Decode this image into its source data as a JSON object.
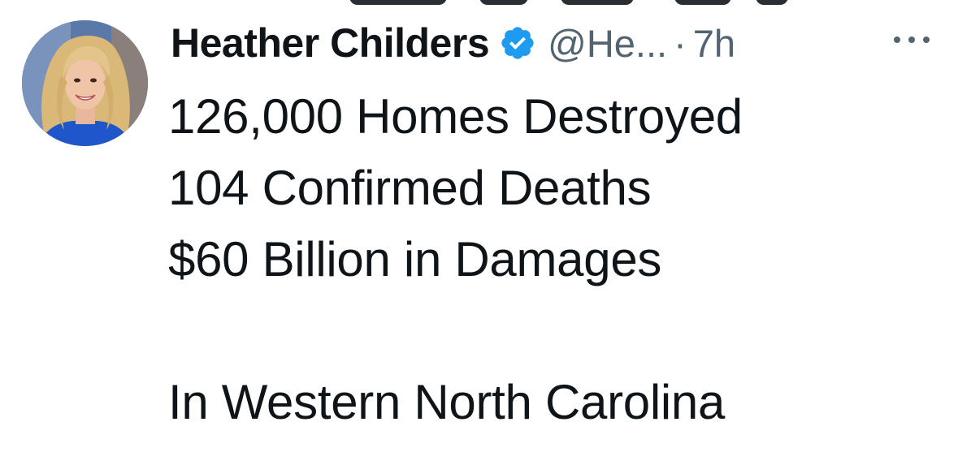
{
  "tweet": {
    "author": {
      "display_name": "Heather Childers",
      "handle": "@He...",
      "verified": true,
      "verified_color": "#1d9bf0"
    },
    "separator": "·",
    "timestamp": "7h",
    "more_icon": "ellipsis-icon",
    "lines": [
      "126,000 Homes Destroyed",
      "104 Confirmed Deaths",
      "$60 Billion in Damages",
      "",
      "In Western North Carolina"
    ]
  }
}
